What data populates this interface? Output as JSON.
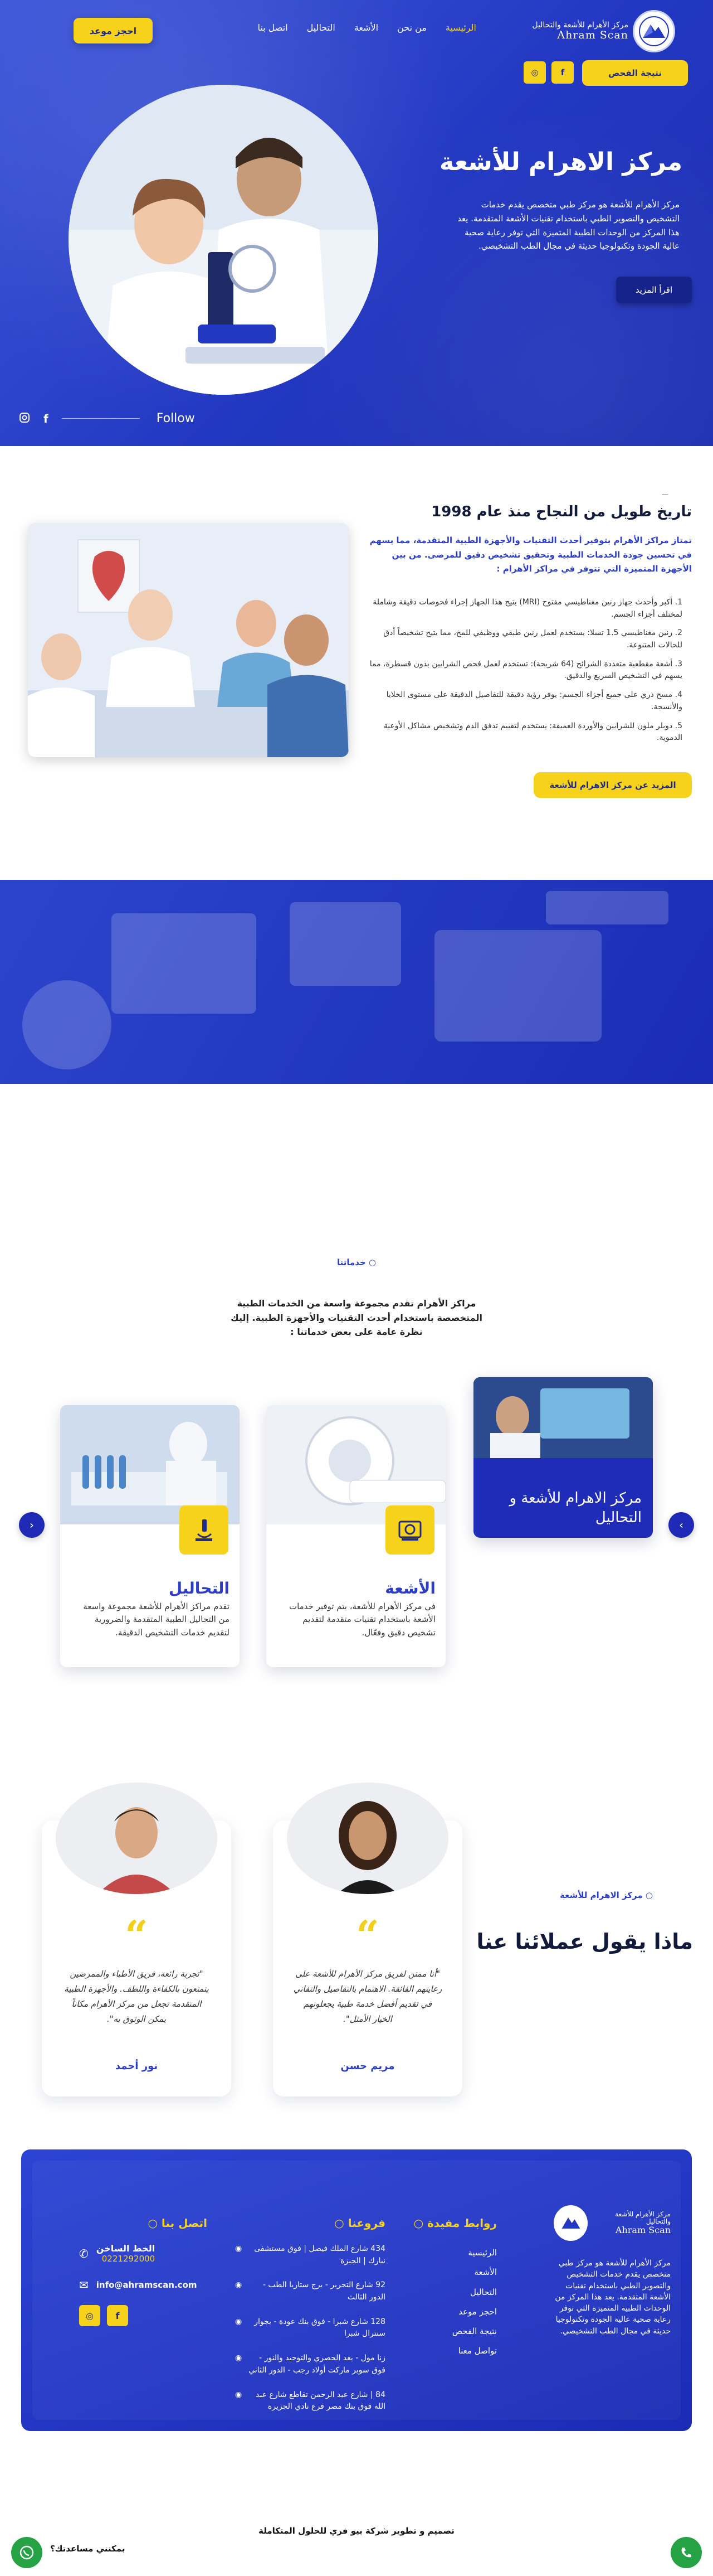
{
  "nav": {
    "logo_ar": "مركز الأهرام للأشعة والتحاليل",
    "logo_en": "Ahram Scan",
    "menu": [
      "الرئيسية",
      "من نحن",
      "الأشعة",
      "التحاليل",
      "اتصل بنا"
    ],
    "book_label": "احجز موعد",
    "result_label": "نتيجة الفحص",
    "social": [
      "f",
      "◎"
    ]
  },
  "hero": {
    "title": "مركز الاهرام للأشعة",
    "desc": "مركز الأهرام للأشعة هو مركز طبي متخصص يقدم خدمات التشخيص والتصوير الطبي باستخدام تقنيات الأشعة المتقدمة. يعد هذا المركز من الوحدات الطبية المتميزة التي توفر رعاية صحية عالية الجودة وتكنولوجيا حديثة في مجال الطب التشخيصي.",
    "more": "اقرأ المزيد",
    "follow": "Follow"
  },
  "about": {
    "kicker": "—",
    "title": "تاريخ طويل من النجاح منذ عام 1998",
    "lead": "تمتاز مراكز الأهرام بتوفير أحدث التقنيات والأجهزة الطبية المتقدمة، مما يسهم في تحسين جودة الخدمات الطبية وتحقيق تشخيص دقيق للمرضى. من بين الأجهزة المتميزة التي تتوفر في مراكز الأهرام :",
    "items": [
      "1. أكبر وأحدث جهاز رنين مغناطيسي مفتوح (MRI) يتيح هذا الجهاز إجراء فحوصات دقيقة وشاملة لمختلف أجزاء الجسم.",
      "2. رنين مغناطيسي 1.5 تسلا: يستخدم لعمل رنين طبقي ووظيفي للمخ، مما يتيح تشخيصاً أدق للحالات المتنوعة.",
      "3. أشعة مقطعية متعددة الشرائح (64 شريحة): تستخدم لعمل فحص الشرايين بدون قسطرة، مما يسهم في التشخيص السريع والدقيق.",
      "4. مسح ذري على جميع أجزاء الجسم: يوفر رؤية دقيقة للتفاصيل الدقيقة على مستوى الخلايا والأنسجة.",
      "5. دوبلر ملون للشرايين والأوردة العميقة: يستخدم لتقييم تدفق الدم وتشخيص مشاكل الأوعية الدموية."
    ],
    "button": "المزيد عن مركز الاهرام للأشعة"
  },
  "services": {
    "kicker": "خدماتنا",
    "intro": "مراكز الأهرام تقدم مجموعة واسعة من الخدمات الطبية المتخصصة باستخدام أحدث التقنيات والأجهزة الطبية. إليك نظرة عامة على بعض خدماتنا :",
    "featured": "مركز الاهرام للأشعة و التحاليل",
    "cards": [
      {
        "title": "الأشعة",
        "desc": "في مركز الأهرام للأشعة، يتم توفير خدمات الأشعة باستخدام تقنيات متقدمة لتقديم تشخيص دقيق وفعّال."
      },
      {
        "title": "التحاليل",
        "desc": "تقدم مراكز الأهرام للأشعة مجموعة واسعة من التحاليل الطبية المتقدمة والضرورية لتقديم خدمات التشخيص الدقيقة."
      }
    ],
    "prev": "‹",
    "next": "›"
  },
  "testimonials": {
    "kicker": "مركز الاهرام للأشعة",
    "title": "ماذا يقول عملائنا عنا",
    "items": [
      {
        "text": "\"أنا ممتن لفريق مركز الأهرام للأشعة على رعايتهم الفائقة. الاهتمام بالتفاصيل والتفاني في تقديم أفضل خدمة طبية يجعلونهم الخيار الأمثل\".",
        "name": "مريم حسن"
      },
      {
        "text": "\"تجربة رائعة، فريق الأطباء والممرضين يتمتعون بالكفاءة واللطف. والأجهزة الطبية المتقدمة تجعل من مركز الأهرام مكاناً يمكن الوثوق به\".",
        "name": "نور أحمد"
      }
    ]
  },
  "footer": {
    "about": "مركز الأهرام للأشعة هو مركز طبي متخصص يقدم خدمات التشخيص والتصوير الطبي باستخدام تقنيات الأشعة المتقدمة. يعد هذا المركز من الوحدات الطبية المتميزة التي توفر رعاية صحية عالية الجودة وتكنولوجيا حديثة في مجال الطب التشخيصي.",
    "links_title": "روابط مفيدة",
    "links": [
      "الرئيسية",
      "الأشعة",
      "التحاليل",
      "احجز موعد",
      "نتيجة الفحص",
      "تواصل معنا"
    ],
    "branches_title": "فروعنا",
    "branches": [
      "434 شارع الملك فيصل | فوق مستشفى نبارك | الجيزة",
      "92 شارع التحرير - برج ستاريا الطب - الدور الثالث",
      "128 شارع شبرا - فوق بنك عودة - بجوار سنترال شبرا",
      "زنا مول - بعد الحصري والتوحيد والنور - فوق سوبر ماركت أولاد رجب - الدور الثاني",
      "84 | شارع عبد الرحمن تقاطع شارع عبد الله فوق بنك مصر فرع نادي الجزيرة"
    ],
    "contact_title": "اتصل بنا",
    "hotline_label": "الخط الساخن",
    "hotline": "0221292000",
    "email": "info@ahramscan.com"
  },
  "bottom": {
    "credit": "تصميم و تطوير شركة بيو فري للحلول المتكاملة",
    "help": "بمكنني مساعدتك؟"
  },
  "colors": {
    "brand_blue": "#2338c2",
    "accent_yellow": "#f7d21a"
  }
}
